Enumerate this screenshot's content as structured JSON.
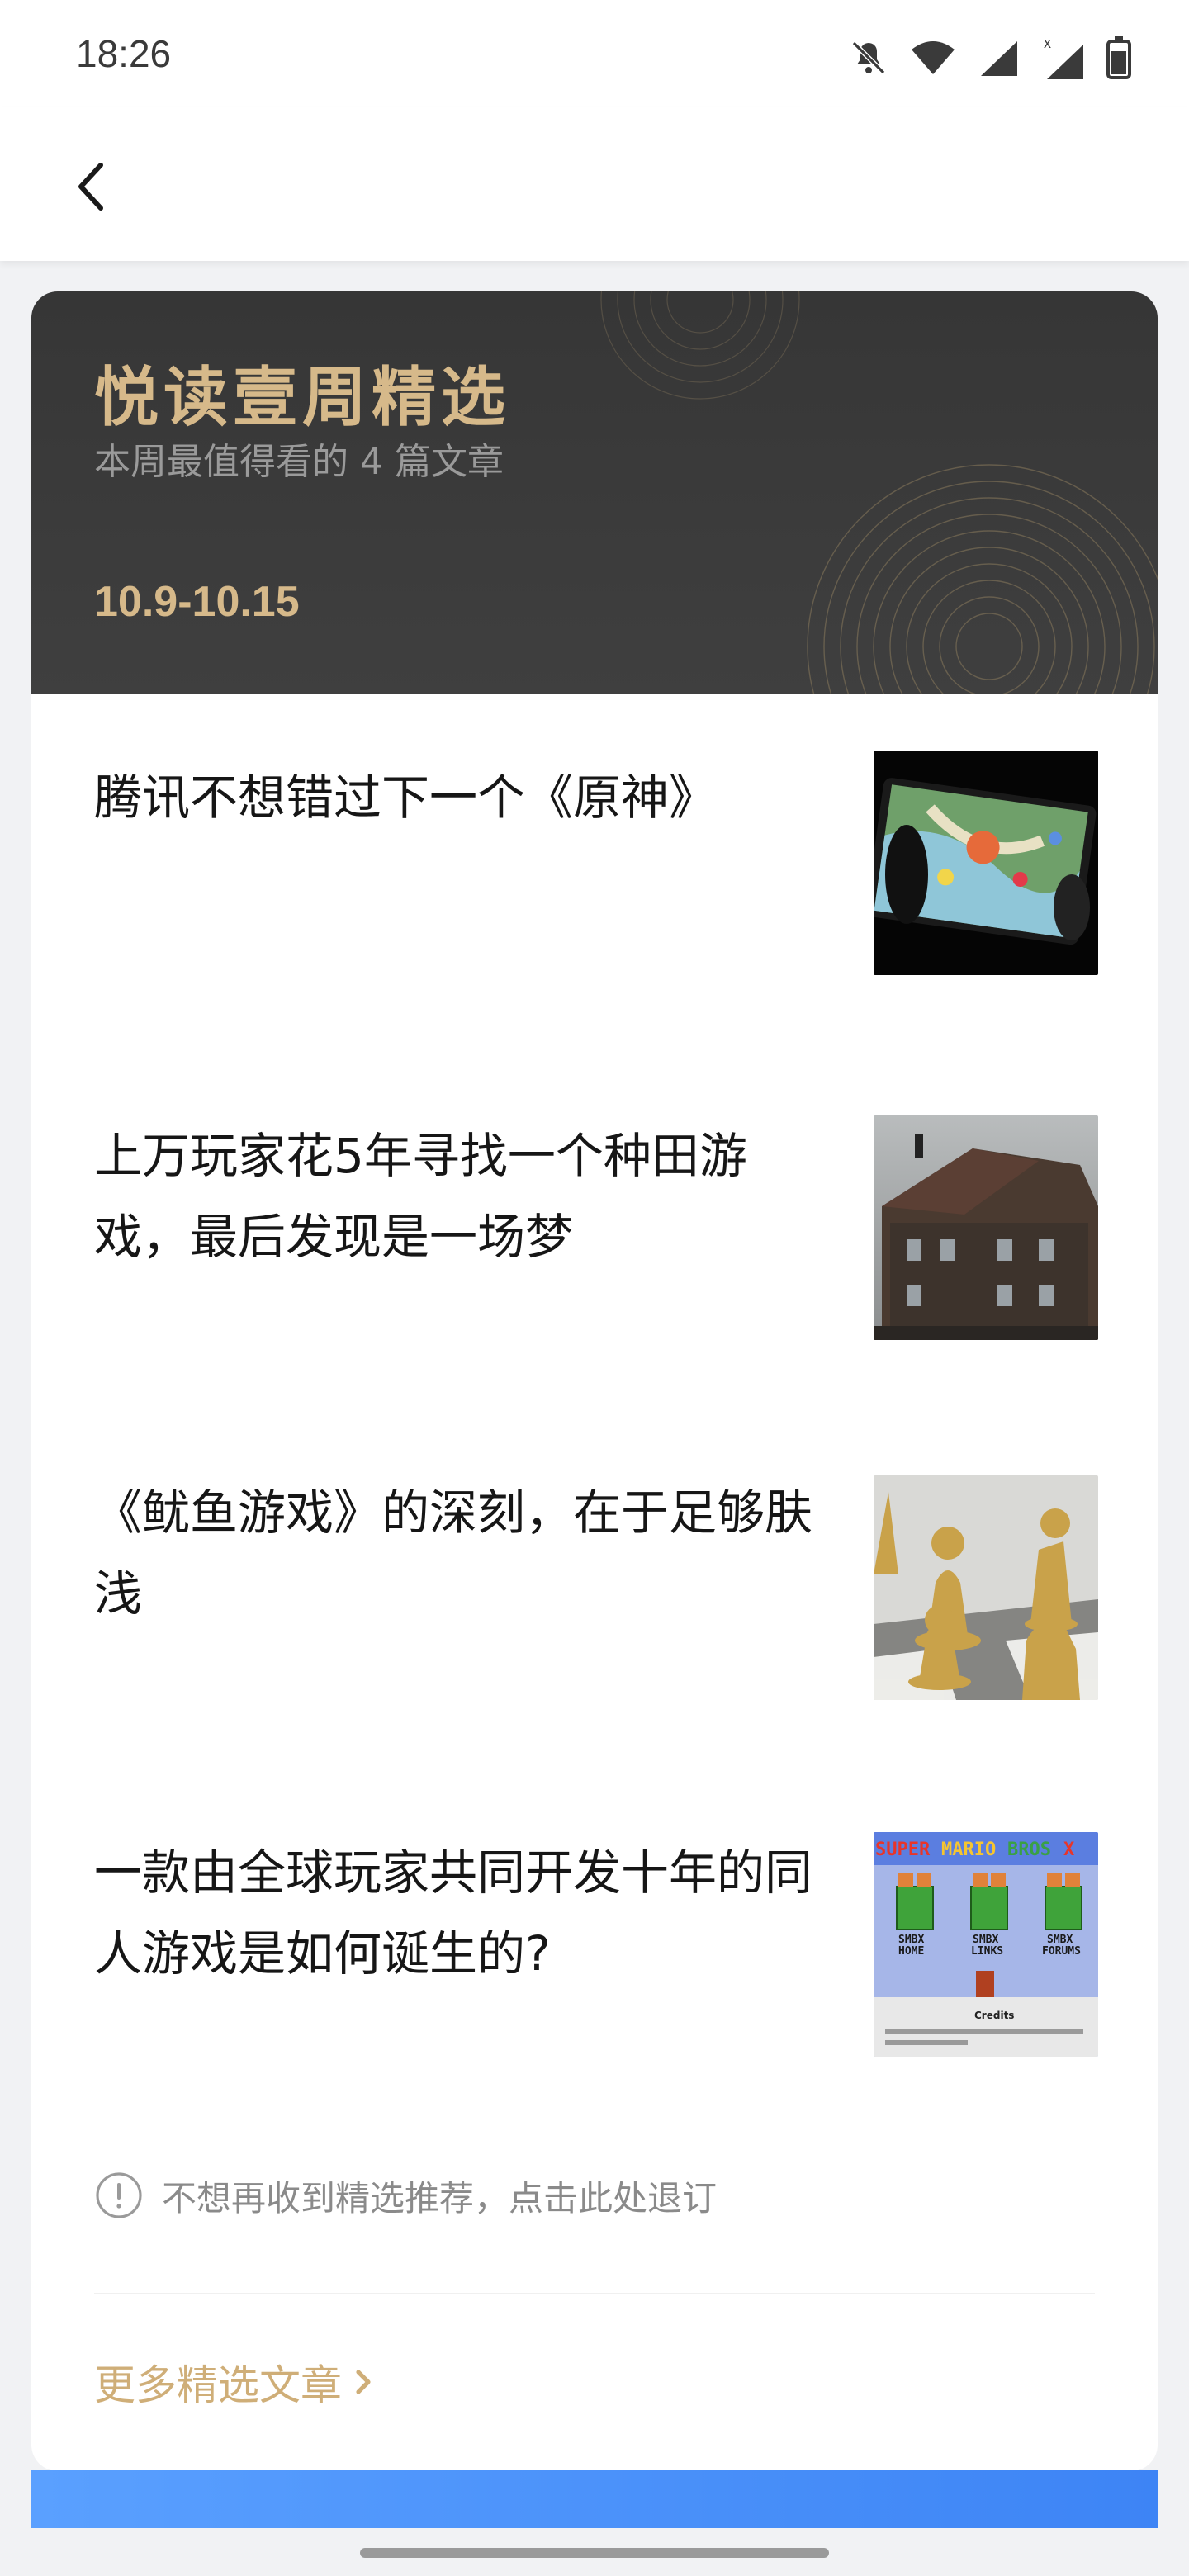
{
  "status_bar": {
    "time": "18:26",
    "icons": [
      "mute-bell-icon",
      "wifi-icon",
      "signal-icon",
      "signal-x-icon",
      "battery-icon"
    ]
  },
  "nav": {
    "back_icon": "chevron-left-icon"
  },
  "header": {
    "title": "悦读壹周精选",
    "subtitle": "本周最值得看的 4 篇文章",
    "date_range": "10.9-10.15"
  },
  "articles": [
    {
      "title": "腾讯不想错过下一个《原神》",
      "thumb": "mobile-game-phone"
    },
    {
      "title": "上万玩家花5年寻找一个种田游戏，最后发现是一场梦",
      "thumb": "old-house"
    },
    {
      "title": "《鱿鱼游戏》的深刻，在于足够肤浅",
      "thumb": "gold-chess"
    },
    {
      "title": "一款由全球玩家共同开发十年的同人游戏是如何诞生的?",
      "thumb": "super-mario-bros-x"
    }
  ],
  "unsubscribe_text": "不想再收到精选推荐，点击此处退订",
  "more_link": "更多精选文章",
  "colors": {
    "gold": "#d6b98a",
    "header_bg": "#3a3a3a",
    "more_link": "#cfae78"
  }
}
